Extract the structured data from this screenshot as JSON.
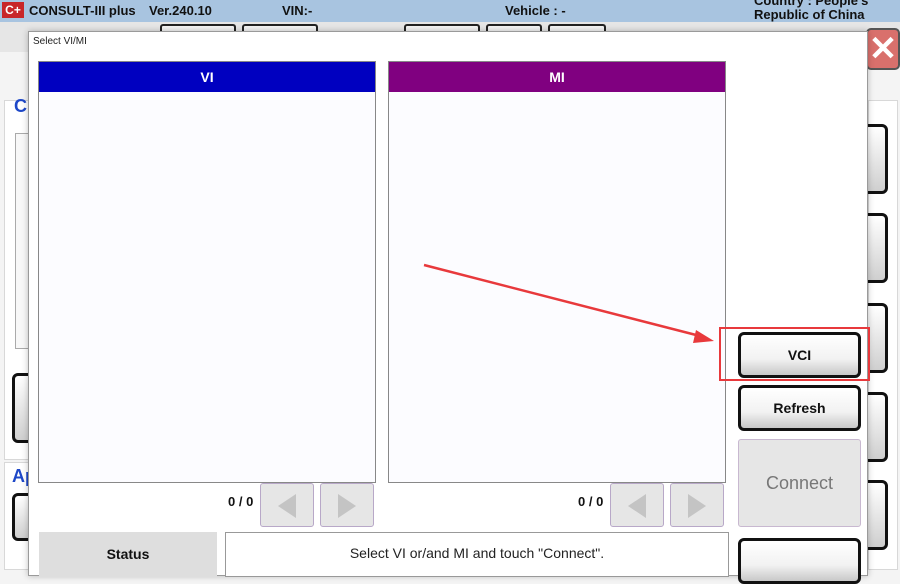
{
  "titlebar": {
    "logo": "C+",
    "app_name": "CONSULT-III plus",
    "version": "Ver.240.10",
    "vin": "VIN:-",
    "vehicle": "Vehicle : -",
    "country_line1": "Country : People's",
    "country_line2": "Republic of China"
  },
  "background": {
    "section1_initial": "C",
    "section2_initial": "Ap"
  },
  "dialog": {
    "title": "Select VI/MI",
    "vi_panel": {
      "header": "VI",
      "header_color": "#0000c0",
      "page_count": "0 / 0",
      "items": []
    },
    "mi_panel": {
      "header": "MI",
      "header_color": "#800080",
      "page_count": "0 / 0",
      "items": []
    },
    "buttons": {
      "vci": "VCI",
      "refresh": "Refresh",
      "connect": "Connect"
    },
    "status": {
      "label": "Status",
      "message": "Select VI or/and MI and touch \"Connect\"."
    }
  },
  "annotation": {
    "highlight_color": "#e8393c",
    "target": "VCI"
  }
}
